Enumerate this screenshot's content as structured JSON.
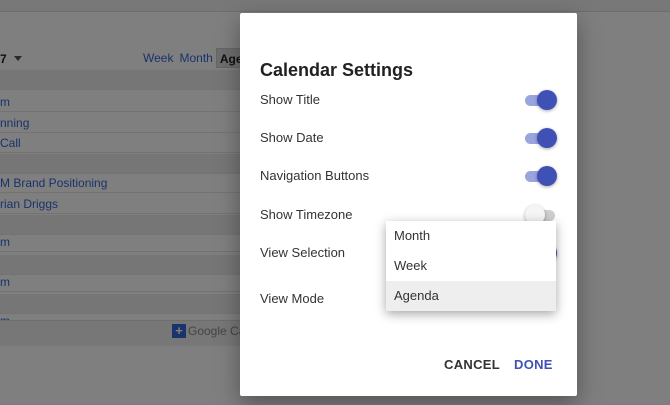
{
  "background": {
    "month_fragment": "7",
    "view_buttons": [
      "Week",
      "Month",
      "Age"
    ],
    "agenda_rows": [
      {
        "text": "",
        "sep": true
      },
      {
        "text": "m",
        "sep": false
      },
      {
        "text": "nning",
        "sep": false
      },
      {
        "text": "Call",
        "sep": false
      },
      {
        "text": "",
        "sep": true
      },
      {
        "text": "M Brand Positioning",
        "sep": false
      },
      {
        "text": "rian Driggs",
        "sep": false
      },
      {
        "text": "",
        "sep": true
      },
      {
        "text": "m",
        "sep": false
      },
      {
        "text": "",
        "sep": true
      },
      {
        "text": "m",
        "sep": false
      },
      {
        "text": "",
        "sep": true
      },
      {
        "text": "m",
        "sep": false
      }
    ],
    "google_calendar_text": "Google Ca"
  },
  "dialog": {
    "title": "Calendar Settings",
    "settings": [
      {
        "label": "Show Title",
        "toggle": true
      },
      {
        "label": "Show Date",
        "toggle": true
      },
      {
        "label": "Navigation Buttons",
        "toggle": true
      },
      {
        "label": "Show Timezone",
        "toggle": false
      },
      {
        "label": "View Selection",
        "toggle": true
      },
      {
        "label": "View Mode",
        "toggle": null
      }
    ],
    "view_mode_options": [
      "Month",
      "Week",
      "Agenda"
    ],
    "view_mode_selected": "Agenda",
    "cancel_label": "CANCEL",
    "done_label": "DONE"
  },
  "colors": {
    "accent": "#3f51b5",
    "toggle_track_on": "#9aa4dd",
    "link": "#3367d6"
  }
}
